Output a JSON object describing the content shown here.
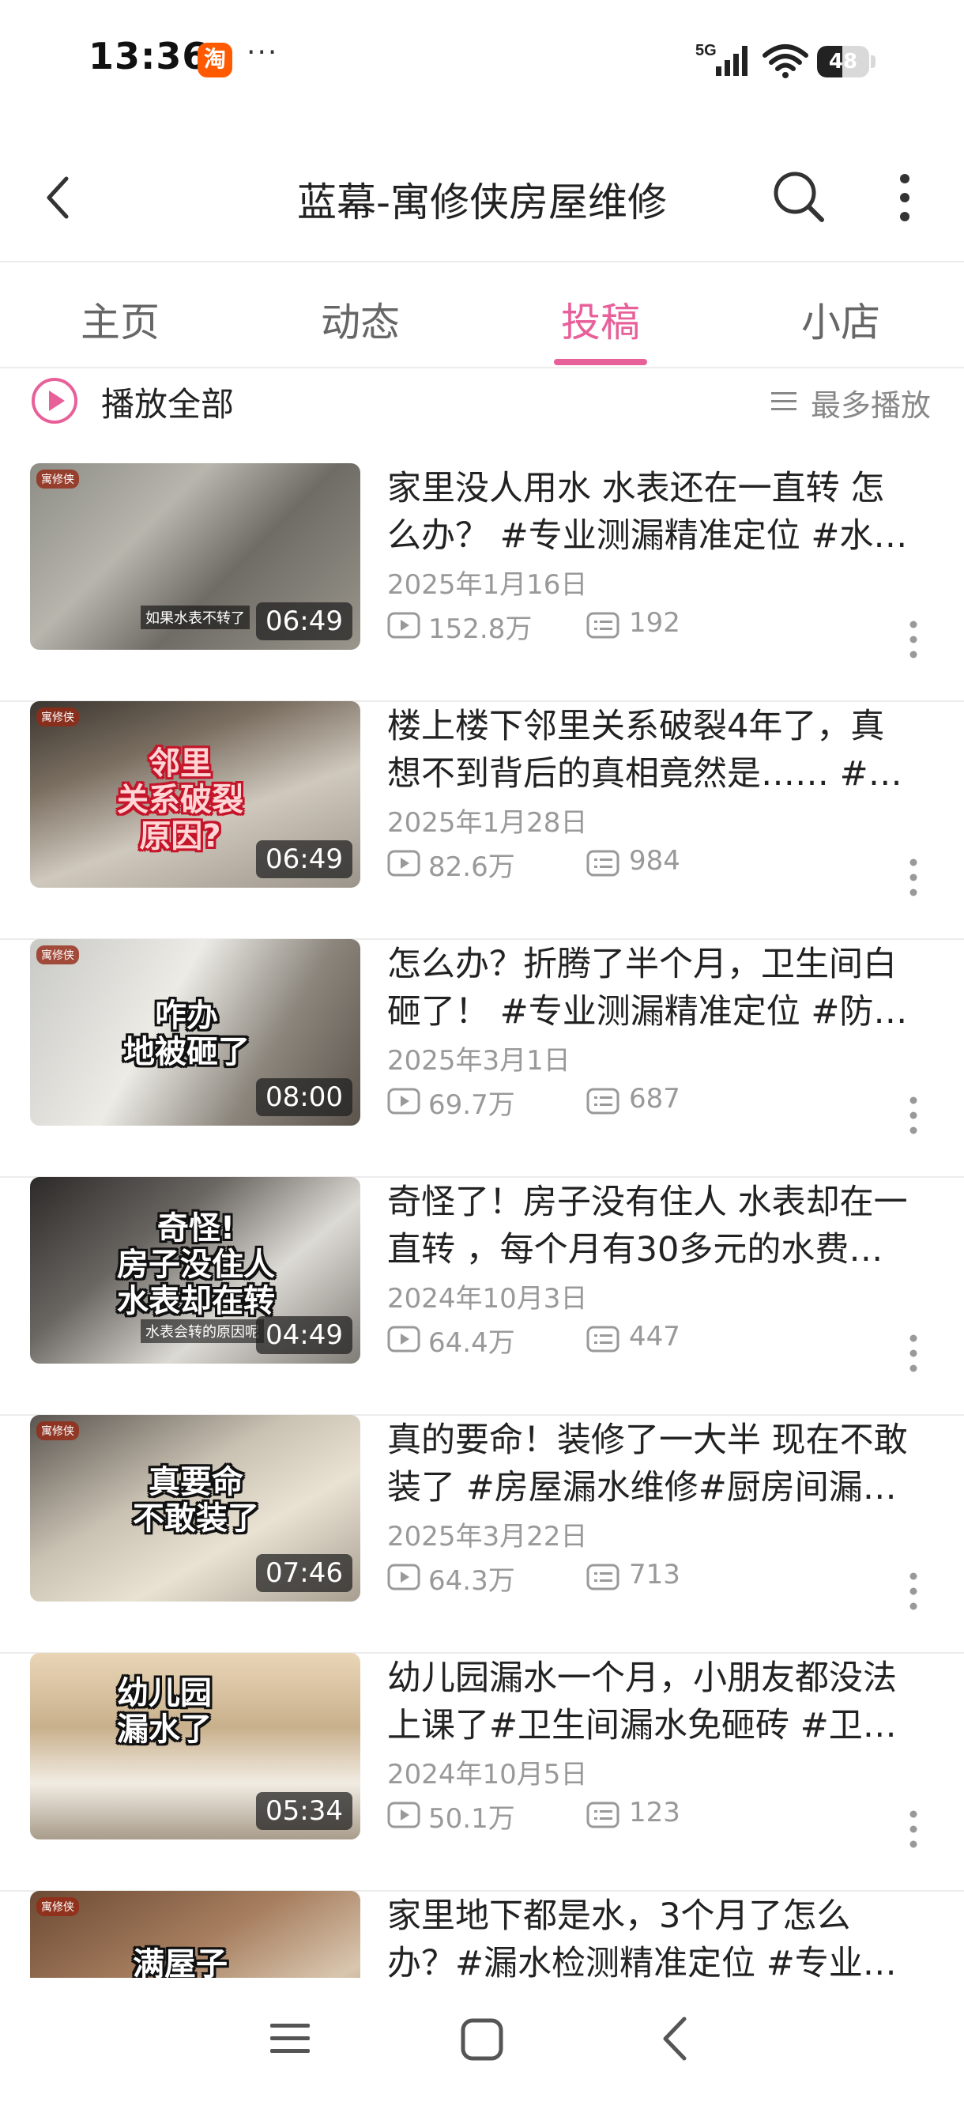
{
  "status_bar": {
    "time": "13:36",
    "app_badge": "淘",
    "dots": "···",
    "network": "5G",
    "battery": "48",
    "battery_level": 0.48
  },
  "header": {
    "title": "蓝幕-寓修侠房屋维修",
    "back_icon": "chevron-left-icon",
    "search_icon": "search-icon",
    "more_icon": "vertical-dots-icon"
  },
  "tabs": [
    {
      "label": "主页",
      "active": false
    },
    {
      "label": "动态",
      "active": false
    },
    {
      "label": "投稿",
      "active": true
    },
    {
      "label": "小店",
      "active": false
    }
  ],
  "accent_color": "#e8609a",
  "toolbar": {
    "play_all": "播放全部",
    "sort": "最多播放"
  },
  "videos": [
    {
      "title_line1": "家里没人用水 水表还在一直转 怎",
      "title_line2": "么办？ #专业测漏精准定位 #水…",
      "date": "2025年1月16日",
      "plays": "152.8万",
      "comments": "192",
      "duration": "06:49",
      "thumb_caption": "",
      "thumb_small": "如果水表不转了",
      "thumb_logo": "寓修侠"
    },
    {
      "title_line1": "楼上楼下邻里关系破裂4年了，真",
      "title_line2": "想不到背后的真相竟然是…… #…",
      "date": "2025年1月28日",
      "plays": "82.6万",
      "comments": "984",
      "duration": "06:49",
      "thumb_caption": "邻里\n关系破裂\n原因?",
      "thumb_small": "",
      "thumb_logo": "寓修侠"
    },
    {
      "title_line1": "怎么办？折腾了半个月，卫生间白",
      "title_line2": "砸了！ #专业测漏精准定位 #防…",
      "date": "2025年3月1日",
      "plays": "69.7万",
      "comments": "687",
      "duration": "08:00",
      "thumb_caption": "咋办\n地被砸了",
      "thumb_small": "",
      "thumb_logo": "寓修侠"
    },
    {
      "title_line1": "奇怪了！房子没有住人 水表却在一",
      "title_line2": "直转 ，每个月有30多元的水费…",
      "date": "2024年10月3日",
      "plays": "64.4万",
      "comments": "447",
      "duration": "04:49",
      "thumb_caption": "奇怪!\n房子没住人\n水表却在转",
      "thumb_small": "水表会转的原因呢",
      "thumb_logo": ""
    },
    {
      "title_line1": "真的要命！装修了一大半 现在不敢",
      "title_line2": "装了 #房屋漏水维修#厨房间漏…",
      "date": "2025年3月22日",
      "plays": "64.3万",
      "comments": "713",
      "duration": "07:46",
      "thumb_caption": "真要命\n不敢装了",
      "thumb_small": "",
      "thumb_logo": "寓修侠"
    },
    {
      "title_line1": "幼儿园漏水一个月，小朋友都没法",
      "title_line2": "上课了#卫生间漏水免砸砖 #卫…",
      "date": "2024年10月5日",
      "plays": "50.1万",
      "comments": "123",
      "duration": "05:34",
      "thumb_caption": "幼儿园\n漏水了",
      "thumb_small": "",
      "thumb_logo": ""
    },
    {
      "title_line1": "家里地下都是水，3个月了怎么",
      "title_line2": "办？#漏水检测精准定位 #专业…",
      "date": "",
      "plays": "",
      "comments": "",
      "duration": "",
      "thumb_caption": "满屋子",
      "thumb_small": "",
      "thumb_logo": "寓修侠"
    }
  ],
  "bottom_nav": {
    "menu_icon": "menu-icon",
    "home_icon": "home-square-icon",
    "back_icon": "back-triangle-icon"
  }
}
